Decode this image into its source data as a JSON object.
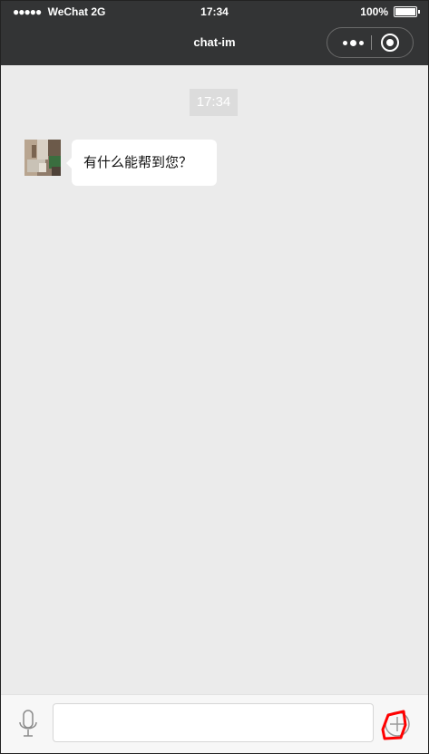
{
  "status_bar": {
    "signal_dots": "●●●●●",
    "carrier": "WeChat 2G",
    "time": "17:34",
    "battery_percent": "100%",
    "battery_level": 1.0
  },
  "nav": {
    "title": "chat-im",
    "more_icon": "more-dots-icon",
    "close_icon": "target-close-icon"
  },
  "chat": {
    "timestamp": "17:34",
    "messages": [
      {
        "sender": "agent",
        "avatar_icon": "avatar-photo",
        "text": "有什么能帮到您？"
      }
    ]
  },
  "composer": {
    "voice_icon": "microphone-icon",
    "input_value": "",
    "input_placeholder": "",
    "plus_icon": "plus-icon",
    "highlight_color": "#ff0000"
  },
  "colors": {
    "topbar": "#333435",
    "background": "#ebebeb",
    "bubble": "#ffffff",
    "timestamp_bg": "#dcdcdc"
  }
}
